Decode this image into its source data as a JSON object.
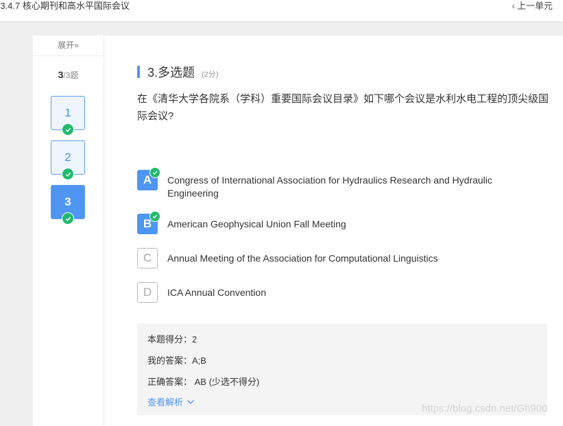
{
  "header": {
    "title": "-3.4.7 核心期刊和高水平国际会议",
    "prev_unit": "上一单元"
  },
  "sidebar": {
    "expand": "展开",
    "progress_current": "3",
    "progress_total": "/3题",
    "questions": [
      {
        "label": "1",
        "state": "done"
      },
      {
        "label": "2",
        "state": "done"
      },
      {
        "label": "3",
        "state": "current-done"
      }
    ]
  },
  "question": {
    "title": "3.多选题",
    "score": "(2分)",
    "text": "在《清华大学各院系（学科）重要国际会议目录》如下哪个会议是水利水电工程的顶尖级国际会议?",
    "options": [
      {
        "letter": "A",
        "text": "Congress of International Association for Hydraulics Research and Hydraulic Engineering",
        "selected": true
      },
      {
        "letter": "B",
        "text": "American Geophysical Union Fall Meeting",
        "selected": true
      },
      {
        "letter": "C",
        "text": "Annual Meeting of the Association for Computational Linguistics",
        "selected": false
      },
      {
        "letter": "D",
        "text": "ICA Annual Convention",
        "selected": false
      }
    ]
  },
  "result": {
    "score": "本题得分：2",
    "my_answer": "我的答案：A;B",
    "correct_answer": "正确答案：  AB (少选不得分)",
    "analysis_link": "查看解析"
  },
  "watermark": "https://blog.csdn.net/Gh900",
  "colors": {
    "accent": "#4e96f2",
    "success": "#1fbb6e"
  }
}
